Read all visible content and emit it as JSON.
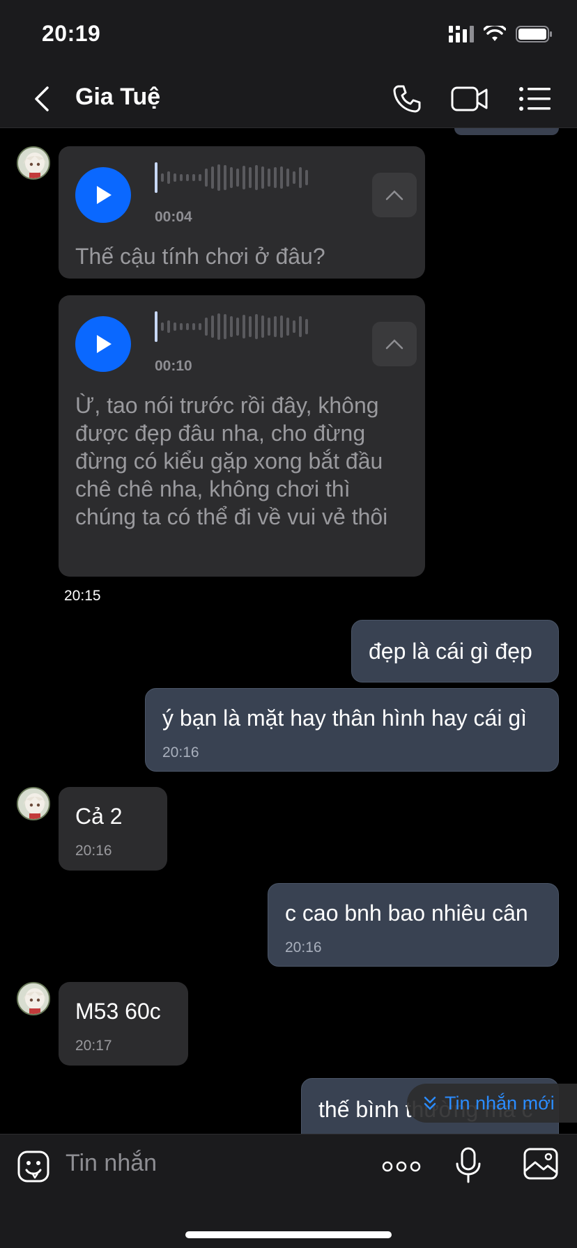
{
  "status": {
    "time": "20:19"
  },
  "header": {
    "title": "Gia Tuệ",
    "back_icon": "chevron-left-icon",
    "call_icon": "phone-icon",
    "video_icon": "video-icon",
    "menu_icon": "list-icon"
  },
  "messages": {
    "voice1": {
      "duration": "00:04",
      "transcript": "Thế cậu tính chơi ở đâu?"
    },
    "voice2": {
      "duration": "00:10",
      "transcript": "Ừ, tao nói trước rồi đây, không được đẹp đâu nha, cho đừng đừng có kiểu gặp xong bắt đầu chê chê nha, không chơi thì chúng ta có thể đi về vui vẻ thôi"
    },
    "time_chip": "20:15",
    "out1": {
      "text": "đẹp là cái gì đẹp"
    },
    "out2": {
      "text": "ý bạn là mặt hay thân hình hay cái gì",
      "time": "20:16"
    },
    "in1": {
      "text": "Cả 2",
      "time": "20:16"
    },
    "out3": {
      "text": "c cao bnh bao nhiêu cân",
      "time": "20:16"
    },
    "in2": {
      "text": "M53 60c",
      "time": "20:17"
    },
    "out4": {
      "text": "thế bình thường mà c"
    }
  },
  "new_messages_label": "Tin nhắn mới",
  "composer": {
    "placeholder": "Tin nhắn"
  },
  "colors": {
    "accent": "#0a68ff",
    "link": "#2b8cff",
    "outgoing_bubble": "#394252",
    "incoming_bubble": "#2c2c2e"
  }
}
